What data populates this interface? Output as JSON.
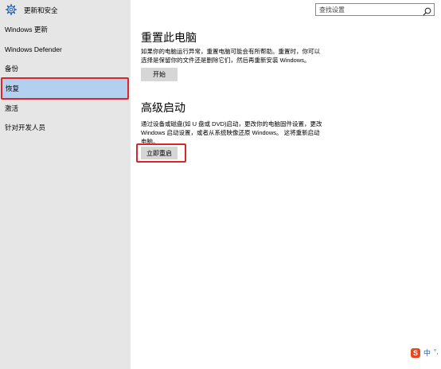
{
  "app": {
    "title": "更新和安全",
    "icon": "gear-icon"
  },
  "search": {
    "placeholder": "查找设置",
    "icon": "search-icon"
  },
  "sidebar": {
    "items": [
      {
        "label": "Windows 更新",
        "selected": false
      },
      {
        "label": "Windows Defender",
        "selected": false
      },
      {
        "label": "备份",
        "selected": false
      },
      {
        "label": "恢复",
        "selected": true
      },
      {
        "label": "激活",
        "selected": false
      },
      {
        "label": "针对开发人员",
        "selected": false
      }
    ]
  },
  "reset": {
    "title": "重置此电脑",
    "description": "如果你的电脑运行异常，重置电脑可能会有所帮助。重置时，你可以选择是保留你的文件还是删除它们，然后再重新安装 Windows。",
    "button": "开始"
  },
  "advanced": {
    "title": "高级启动",
    "description": "通过设备或磁盘(如 U 盘或 DVD)启动，更改你的电脑固件设置，更改 Windows 启动设置，或者从系统映像还原 Windows。 这将重新启动电脑。",
    "button": "立即重启"
  },
  "ime": {
    "logo": "S",
    "mode": "中",
    "extra": "°,"
  },
  "colors": {
    "sidebar_bg": "#e6e6e6",
    "selected_bg": "#b3d1ef",
    "highlight_border": "#d9262c",
    "button_bg": "#d6d6d6"
  }
}
